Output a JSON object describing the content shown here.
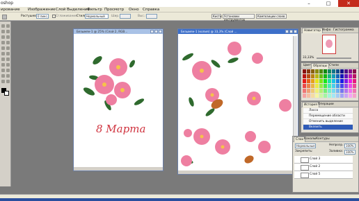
{
  "app": {
    "title": "oshop"
  },
  "window_controls": {
    "minimize": "–",
    "maximize": "□",
    "close": "✕"
  },
  "menu": [
    "ирование",
    "Изображение",
    "Слой",
    "Выделение",
    "Фильтр",
    "Просмотр",
    "Окно",
    "Справка"
  ],
  "options": {
    "feather_label": "Растушевка:",
    "feather_value": "0 пикс.",
    "smooth_label": "Сглаживание",
    "style_label": "Стиль:",
    "style_value": "Нормальный",
    "width_label": "Шир.:",
    "height_label": "Выс.:",
    "tabs": [
      "Кисти",
      "Установки инструментов",
      "Композиции слоев"
    ]
  },
  "doc1": {
    "title": "Безымян-1 @ 25% (Слой 2, RGB...",
    "text": "8 Марта"
  },
  "doc2": {
    "title": "Безымян-1 (копия) @ 33,3% (Слой ..."
  },
  "navigator": {
    "tabs": [
      "Навигатор",
      "Инфо",
      "Гистограмма"
    ],
    "zoom": "33,33%"
  },
  "swatches": {
    "tabs": [
      "Цвет",
      "Образцы",
      "Стили"
    ]
  },
  "history": {
    "tabs": [
      "История",
      "Операции"
    ],
    "items": [
      "Лассо",
      "Перемещение области",
      "Отменить выделение",
      "Вклеить"
    ]
  },
  "layers": {
    "tabs": [
      "Слои",
      "Каналы",
      "Контуры"
    ],
    "mode": "Нормальные",
    "opacity_label": "Непрозр.:",
    "opacity_value": "100%",
    "lock_label": "Закрепить:",
    "fill_label": "Заливка:",
    "fill_value": "100%",
    "items": [
      "Слой 3",
      "Слой 2",
      "Слой 5"
    ]
  },
  "colors": {
    "accent": "#2f5bb7",
    "flower": "#ee7fa1",
    "leaf": "#2f6a2e",
    "script_text": "#d0333f"
  }
}
